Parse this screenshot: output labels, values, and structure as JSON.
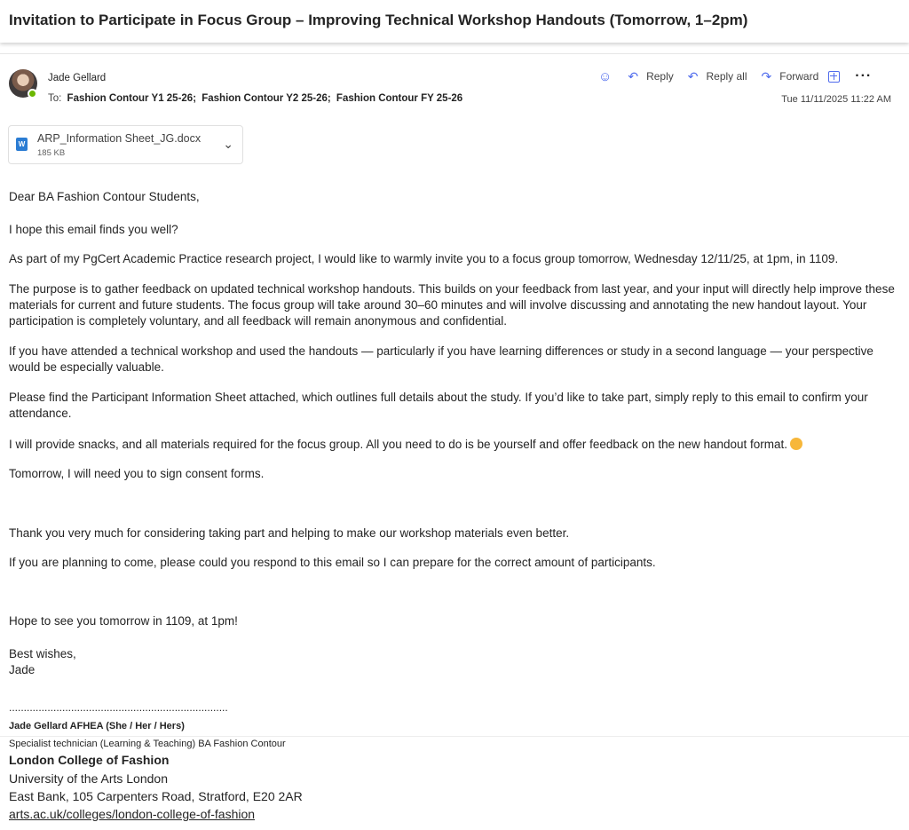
{
  "email": {
    "subject": "Invitation to Participate in Focus Group – Improving Technical Workshop Handouts (Tomorrow, 1–2pm)",
    "sender": "Jade Gellard",
    "to_label": "To:",
    "recipients": [
      "Fashion Contour Y1 25-26;",
      "Fashion Contour Y2 25-26;",
      "Fashion Contour FY 25-26"
    ],
    "datetime": "Tue 11/11/2025 11:22 AM"
  },
  "actions": {
    "reply": "Reply",
    "reply_all": "Reply all",
    "forward": "Forward",
    "emoji_icon": "smiley-icon",
    "apps_icon": "apps-icon",
    "more": "···"
  },
  "attachment": {
    "name": "ARP_Information Sheet_JG.docx",
    "size": "185 KB",
    "icon": "word-doc-icon"
  },
  "body": {
    "greeting": "Dear BA Fashion Contour Students,",
    "p1": "I hope this email finds you well?",
    "p2": "As part of my PgCert Academic Practice research project, I would like to warmly invite you to a focus group tomorrow, Wednesday 12/11/25,  at 1pm, in 1109.",
    "p3": "The purpose is to gather feedback on updated technical workshop handouts. This builds on your feedback from last year, and your input will directly help improve these materials for current and future students. The focus group will take around 30–60 minutes and will involve discussing and annotating the new handout layout. Your participation is completely voluntary, and all feedback will remain anonymous and confidential.",
    "p4": "If you have attended a technical workshop and used the handouts — particularly if you have learning differences or study in a second language — your perspective would be especially valuable.",
    "p5": "Please find the Participant Information Sheet attached, which outlines full details about the study. If you’d like to take part, simply reply to this email to confirm your attendance.",
    "p6": "I will provide snacks, and all materials required for the focus group. All you need to do is be yourself and offer feedback on the new handout format.",
    "p7": "Tomorrow, I will need you to sign consent forms.",
    "p8": "Thank you very much for considering taking part and helping to make our workshop materials even better.",
    "p9": "If you are planning to come, please could you respond to this email so I can prepare for the correct amount of participants.",
    "p10": "Hope to see you tomorrow in 1109, at 1pm!",
    "signoff1": "Best wishes,",
    "signoff2": "Jade"
  },
  "signature": {
    "rule": "..........................................................................",
    "name": "Jade Gellard AFHEA (She / Her / Hers)",
    "role": "Specialist technician (Learning & Teaching) BA Fashion Contour",
    "college": "London College of Fashion",
    "university": "University of the Arts London",
    "address": "East Bank, 105 Carpenters Road, Stratford, E20 2AR",
    "link": "arts.ac.uk/colleges/london-college-of-fashion"
  },
  "colors": {
    "accent": "#4f6bed",
    "presence": "#6bb700",
    "word": "#2b7cd3"
  }
}
